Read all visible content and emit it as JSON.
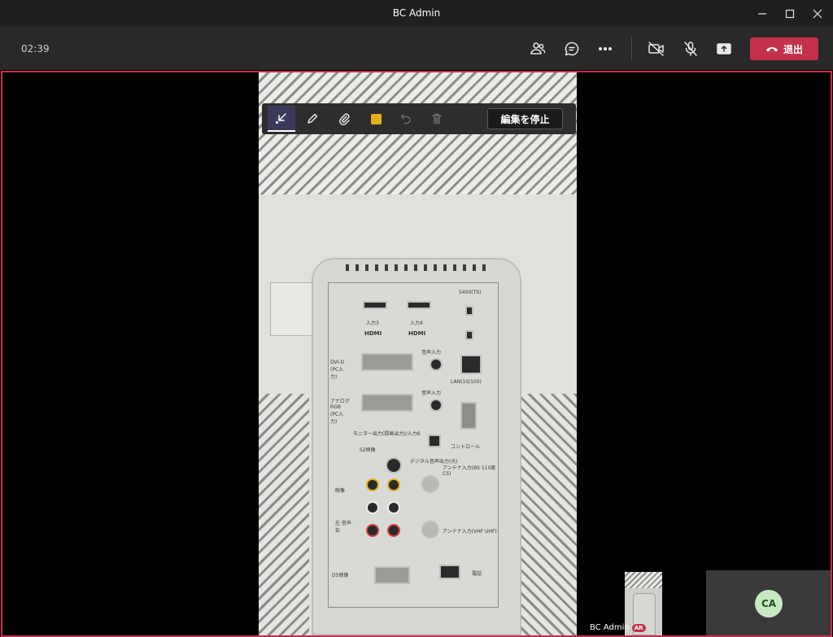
{
  "window": {
    "title": "BC Admin"
  },
  "call": {
    "timer": "02:39",
    "leave_label": "退出"
  },
  "annotation": {
    "stop_label": "編集を停止",
    "ink_color": "#e3b219"
  },
  "equipment_labels": {
    "hdmi_in3": "入力3",
    "hdmi_in4": "入力4",
    "hdmi_logo": "HDMI",
    "s400": "S400(TS)",
    "lan": "LAN(10/100)",
    "dvi": "DVI-D (PC入力)",
    "analog_rgb": "アナログ RGB (PC入力)",
    "audio_in": "音声入力",
    "monitor_out": "モニター出力(録画出力)/入力6",
    "s2": "S2映像",
    "digital_audio_out": "デジタル音声出力(光)",
    "control": "コントロール",
    "antenna_bs": "アンテナ入力(BS·110度CS)",
    "antenna_vhf": "アンテナ入力(VHF·UHF)",
    "video": "映像",
    "audio_lr": "左·音声·右",
    "d5": "D5映像",
    "phone": "電話"
  },
  "participants": {
    "self_name": "BC Admin",
    "self_badge": "AR",
    "remote_initials": "CA"
  },
  "colors": {
    "accent_red": "#c4314b",
    "avatar_bg": "#c7e8c3"
  }
}
